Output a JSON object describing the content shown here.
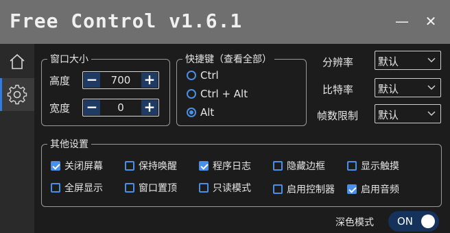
{
  "app": {
    "title": "Free Control v1.6.1"
  },
  "window_controls": {
    "minimize_label": "—",
    "close_label": "✕"
  },
  "sidebar": {
    "items": [
      {
        "icon": "home-icon"
      },
      {
        "icon": "gear-icon"
      }
    ]
  },
  "window_size": {
    "legend": "窗口大小",
    "height_label": "高度",
    "height_value": "700",
    "width_label": "宽度",
    "width_value": "0",
    "minus_label": "−",
    "plus_label": "+"
  },
  "hotkey": {
    "legend": "快捷键（查看全部）",
    "options": [
      {
        "label": "Ctrl",
        "selected": false
      },
      {
        "label": "Ctrl + Alt",
        "selected": false
      },
      {
        "label": "Alt",
        "selected": true
      }
    ]
  },
  "settings": {
    "resolution_label": "分辨率",
    "resolution_value": "默认",
    "bitrate_label": "比特率",
    "bitrate_value": "默认",
    "fps_label": "帧数限制",
    "fps_value": "默认"
  },
  "other": {
    "legend": "其他设置",
    "checkboxes": [
      {
        "label": "关闭屏幕",
        "checked": true
      },
      {
        "label": "保持唤醒",
        "checked": false
      },
      {
        "label": "程序日志",
        "checked": true
      },
      {
        "label": "隐藏边框",
        "checked": false
      },
      {
        "label": "显示触摸",
        "checked": false
      },
      {
        "label": "全屏显示",
        "checked": false
      },
      {
        "label": "窗口置顶",
        "checked": false
      },
      {
        "label": "只读模式",
        "checked": false
      },
      {
        "label": "启用控制器",
        "checked": false
      },
      {
        "label": "启用音频",
        "checked": true
      }
    ]
  },
  "dark_mode": {
    "label": "深色模式",
    "toggle_label": "ON",
    "on": true
  },
  "colors": {
    "accent": "#4a8fe8",
    "titlebar": "#6f6f6f",
    "background": "#1c1c1c",
    "toggle_bg": "#14325a"
  }
}
